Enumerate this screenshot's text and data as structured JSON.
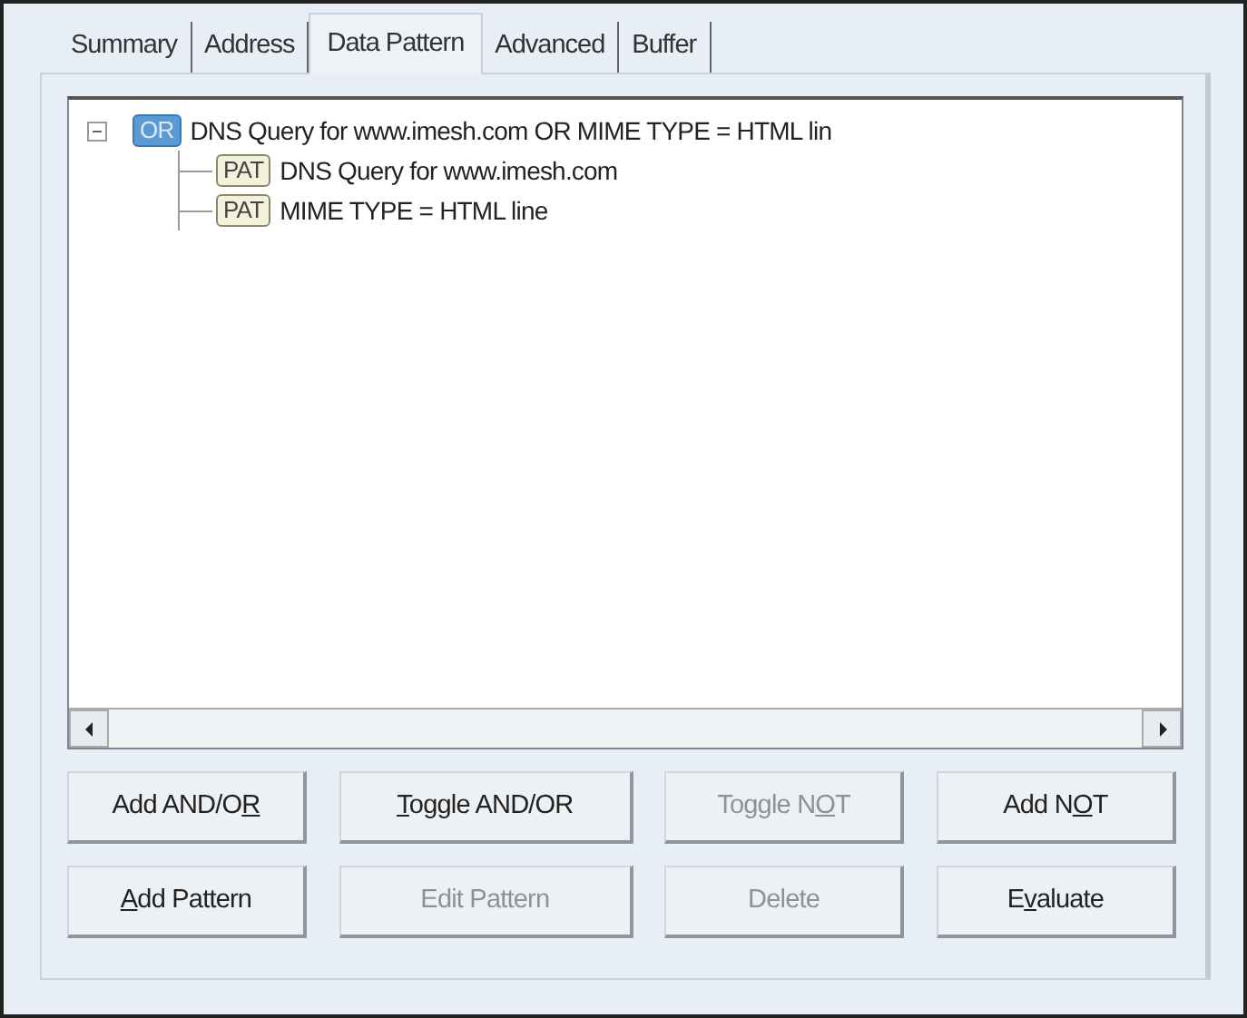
{
  "tabs": [
    {
      "label": "Summary",
      "selected": false
    },
    {
      "label": "Address",
      "selected": false
    },
    {
      "label": "Data Pattern",
      "selected": true
    },
    {
      "label": "Advanced",
      "selected": false
    },
    {
      "label": "Buffer",
      "selected": false
    }
  ],
  "tree": [
    {
      "badge": "OR",
      "text": "DNS Query for www.imesh.com OR MIME TYPE = HTML lin",
      "selected": true,
      "expanded": true,
      "children": [
        {
          "badge": "PAT",
          "text": "DNS Query for www.imesh.com",
          "selected": false
        },
        {
          "badge": "PAT",
          "text": "MIME TYPE = HTML line",
          "selected": false
        }
      ]
    }
  ],
  "button_rows": [
    [
      {
        "text_before": "Add AND/O",
        "underlined": "R",
        "disabled": false
      },
      {
        "underlined": "T",
        "text_after": "oggle AND/OR",
        "disabled": false
      },
      {
        "text_before": "Toggle N",
        "underlined": "O",
        "text_after": "T",
        "disabled": true
      },
      {
        "text_before": "Add N",
        "underlined": "O",
        "text_after": "T",
        "disabled": false
      }
    ],
    [
      {
        "underlined": "A",
        "text_after": "dd Pattern",
        "disabled": false
      },
      {
        "text_before": "Edit Pattern",
        "disabled": true
      },
      {
        "text_before": "Delete",
        "disabled": true
      },
      {
        "text_before": "E",
        "underlined": "v",
        "text_after": "aluate",
        "disabled": false
      }
    ]
  ]
}
